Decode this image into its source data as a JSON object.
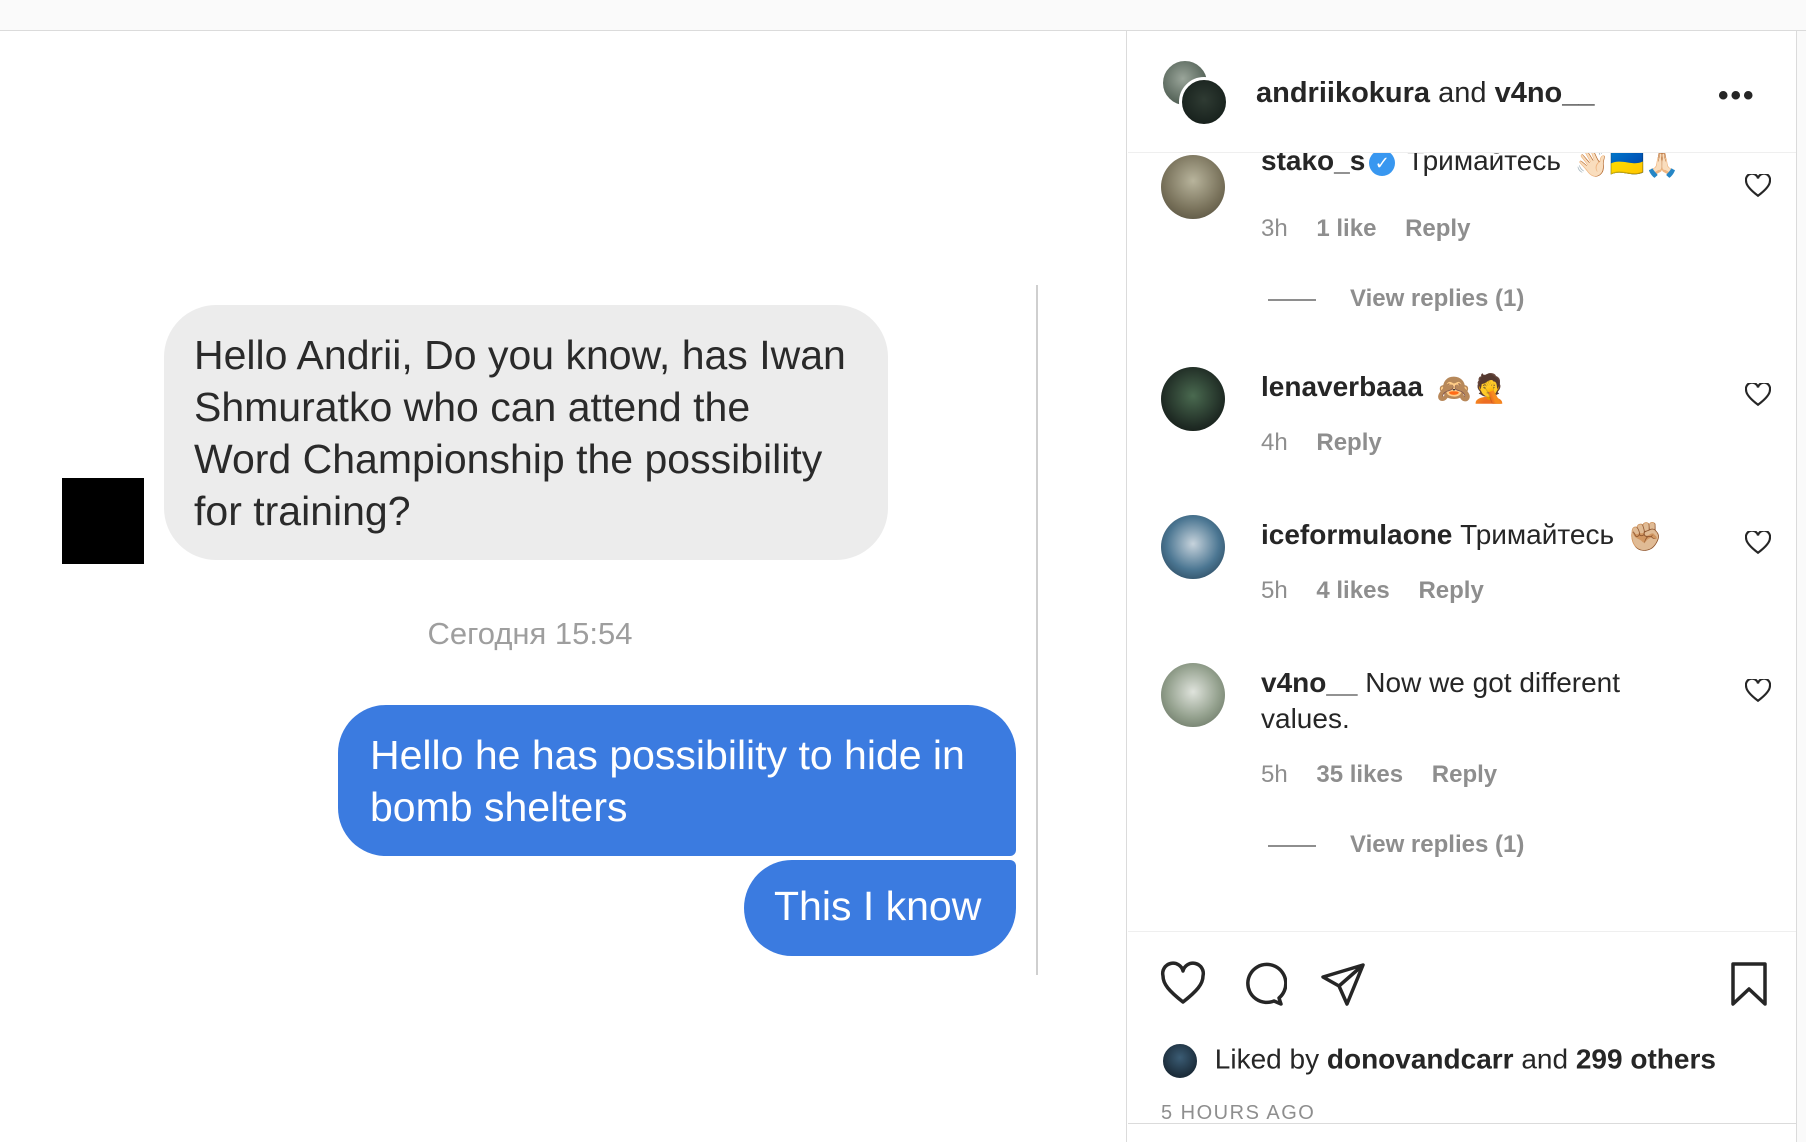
{
  "media": {
    "incoming_message": "Hello Andrii, Do you know, has Iwan Shmuratko who can attend the Word Championship the possibility for training?",
    "timestamp": "Сегодня 15:54",
    "outgoing_messages": [
      "Hello he has possibility to hide in bomb shelters",
      "This I know"
    ]
  },
  "header": {
    "user1": "andriikokura",
    "joiner": "and",
    "user2": "v4no__",
    "more_label": "•••"
  },
  "comments": [
    {
      "user": "stako_s",
      "verified": true,
      "text": "Тримайтесь",
      "emojis": "👋🏻🇺🇦🙏🏻",
      "time": "3h",
      "likes": "1 like",
      "reply": "Reply",
      "view_replies": "View replies (1)"
    },
    {
      "user": "lenaverbaaa",
      "text": "",
      "emojis": "🙈🤦",
      "time": "4h",
      "likes": "",
      "reply": "Reply"
    },
    {
      "user": "iceformulaone",
      "text": "Тримайтесь",
      "emojis": "✊🏼",
      "time": "5h",
      "likes": "4 likes",
      "reply": "Reply"
    },
    {
      "user": "v4no__",
      "text": "Now we got different values.",
      "emojis": "",
      "time": "5h",
      "likes": "35 likes",
      "reply": "Reply",
      "view_replies": "View replies (1)"
    }
  ],
  "footer": {
    "liked_prefix": "Liked by",
    "liked_user": "donovandcarr",
    "liked_and": "and",
    "liked_others": "299 others",
    "ago": "5 HOURS AGO"
  },
  "colors": {
    "outgoing_bubble": "#3b7be0",
    "incoming_bubble": "#ececec",
    "verified": "#3897f0"
  }
}
